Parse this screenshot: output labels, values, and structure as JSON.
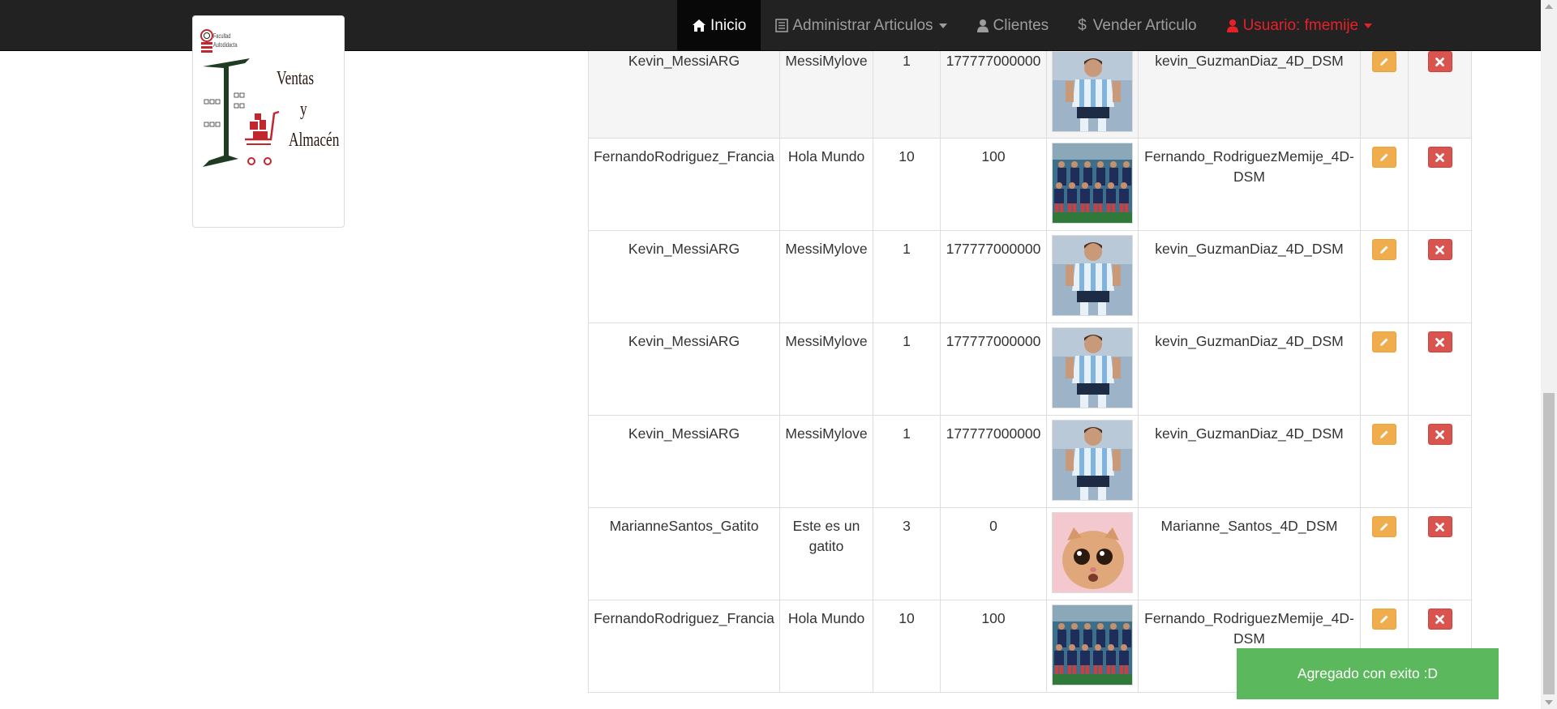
{
  "navbar": {
    "items": [
      {
        "label": "Inicio",
        "icon": "home-icon",
        "active": true
      },
      {
        "label": "Administrar Articulos",
        "icon": "list-icon",
        "dropdown": true
      },
      {
        "label": "Clientes",
        "icon": "user-icon"
      },
      {
        "label": "Vender Articulo",
        "icon": "dollar-icon"
      },
      {
        "label": "Usuario: fmemije",
        "icon": "user-icon",
        "dropdown": true
      }
    ]
  },
  "logo": {
    "title_line1": "Ventas",
    "title_line2": "y",
    "title_line3": "Almacén",
    "small_line1": "Facultad",
    "small_line2": "Autodidacta"
  },
  "table": {
    "rows": [
      {
        "name": "Kevin_MessiARG",
        "description": "MessiMylove",
        "quantity": "1",
        "price": "177777000000",
        "image": "messi-photo",
        "owner": "kevin_GuzmanDiaz_4D_DSM"
      },
      {
        "name": "FernandoRodriguez_Francia",
        "description": "Hola Mundo",
        "quantity": "10",
        "price": "100",
        "image": "france-team-photo",
        "owner": "Fernando_RodriguezMemije_4D-DSM"
      },
      {
        "name": "Kevin_MessiARG",
        "description": "MessiMylove",
        "quantity": "1",
        "price": "177777000000",
        "image": "messi-photo",
        "owner": "kevin_GuzmanDiaz_4D_DSM"
      },
      {
        "name": "Kevin_MessiARG",
        "description": "MessiMylove",
        "quantity": "1",
        "price": "177777000000",
        "image": "messi-photo",
        "owner": "kevin_GuzmanDiaz_4D_DSM"
      },
      {
        "name": "Kevin_MessiARG",
        "description": "MessiMylove",
        "quantity": "1",
        "price": "177777000000",
        "image": "messi-photo",
        "owner": "kevin_GuzmanDiaz_4D_DSM"
      },
      {
        "name": "MarianneSantos_Gatito",
        "description": "Este es un gatito",
        "quantity": "3",
        "price": "0",
        "image": "cat-photo",
        "owner": "Marianne_Santos_4D_DSM"
      },
      {
        "name": "FernandoRodriguez_Francia",
        "description": "Hola Mundo",
        "quantity": "10",
        "price": "100",
        "image": "france-team-photo",
        "owner": "Fernando_RodriguezMemije_4D-DSM"
      }
    ]
  },
  "toast": {
    "message": "Agregado con exito :D"
  },
  "colors": {
    "navbar_bg": "#222222",
    "nav_active_bg": "#080808",
    "user_red": "#e8202a",
    "edit_button": "#f0ad4e",
    "delete_button": "#d9534f",
    "toast_green": "#5cb85c"
  }
}
